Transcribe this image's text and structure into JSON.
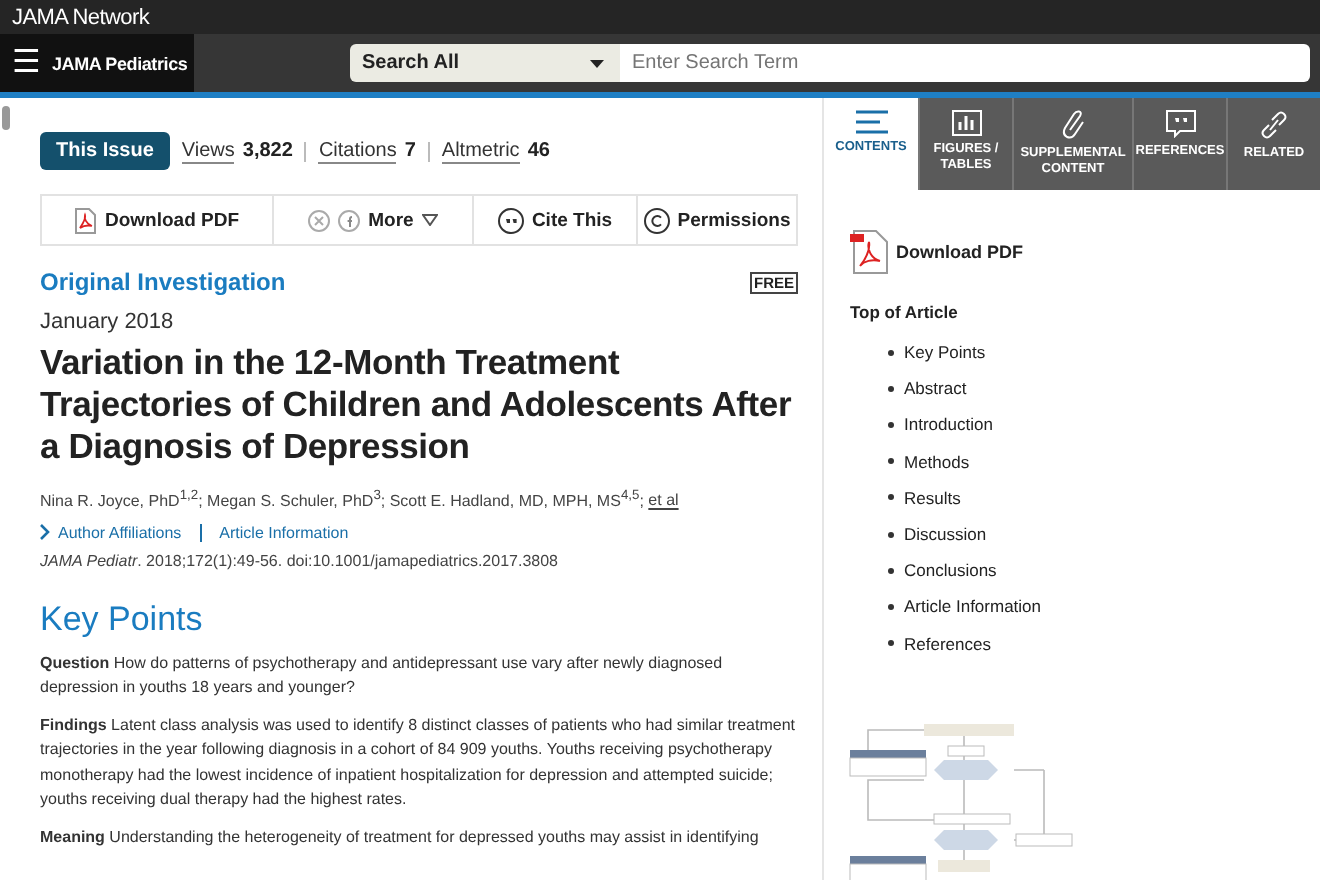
{
  "network_bar": {
    "brand": "JAMA Network"
  },
  "header": {
    "menu_icon": "☰",
    "journal": "JAMA Pediatrics",
    "search_scope": "Search All",
    "search_placeholder": "Enter Search Term"
  },
  "article": {
    "issue_button": "This Issue",
    "metrics": [
      {
        "label": "Views",
        "value": "3,822"
      },
      {
        "label": "Citations",
        "value": "7"
      },
      {
        "label": "Altmetric",
        "value": "46"
      }
    ],
    "actions": [
      {
        "kind": "pdf",
        "label": "Download PDF"
      },
      {
        "kind": "share",
        "label": "More"
      },
      {
        "kind": "cite",
        "label": "Cite This"
      },
      {
        "kind": "permissions",
        "label": "Permissions"
      }
    ],
    "type": "Original Investigation",
    "free_badge": "FREE",
    "date": "January 2018",
    "title": "Variation in the 12-Month Treatment Trajectories of Children and Adolescents After a Diagnosis of Depression",
    "authors": "Nina R. Joyce, PhD$^{1,2}$; Megan S. Schuler, PhD$^{3}$; Scott E. Hadland, MD, MPH, MS$^{4,5}$;",
    "et_al": "et al",
    "links": [
      "Author Affiliations",
      "Article Information"
    ],
    "citation": "*JAMA Pediatr*. 2018;172(1):49-56. doi:10.1001/jamapediatrics.2017.3808",
    "section_heading": "Key Points",
    "paragraphs": [
      "**Question**  How do patterns of psychotherapy and antidepressant use vary after newly diagnosed depression in youths 18 years and younger?",
      "**Findings**  Latent class analysis was used to identify 8 distinct classes of patients who had similar treatment trajectories in the year following diagnosis in a cohort of 84 909 youths. Youths receiving psychotherapy monotherapy had the lowest incidence of inpatient hospitalization for depression and attempted suicide; youths receiving dual therapy had the highest rates.",
      "**Meaning**  Understanding the heterogeneity of treatment for depressed youths may assist in identifying"
    ]
  },
  "sidebar": {
    "tabs": [
      {
        "kind": "contents",
        "label": "CONTENTS",
        "selected": true
      },
      {
        "kind": "figures",
        "label": "FIGURES / TABLES",
        "selected": false
      },
      {
        "kind": "supplemental",
        "label": "SUPPLEMENTAL CONTENT",
        "selected": false
      },
      {
        "kind": "references",
        "label": "REFERENCES",
        "selected": false
      },
      {
        "kind": "related",
        "label": "RELATED",
        "selected": false
      }
    ],
    "download": "Download PDF",
    "toc_heading": "Top of Article",
    "toc": [
      "Key Points",
      "Abstract",
      "Introduction",
      "Methods",
      "Results",
      "Discussion",
      "Conclusions",
      "Article Information",
      "References"
    ]
  }
}
